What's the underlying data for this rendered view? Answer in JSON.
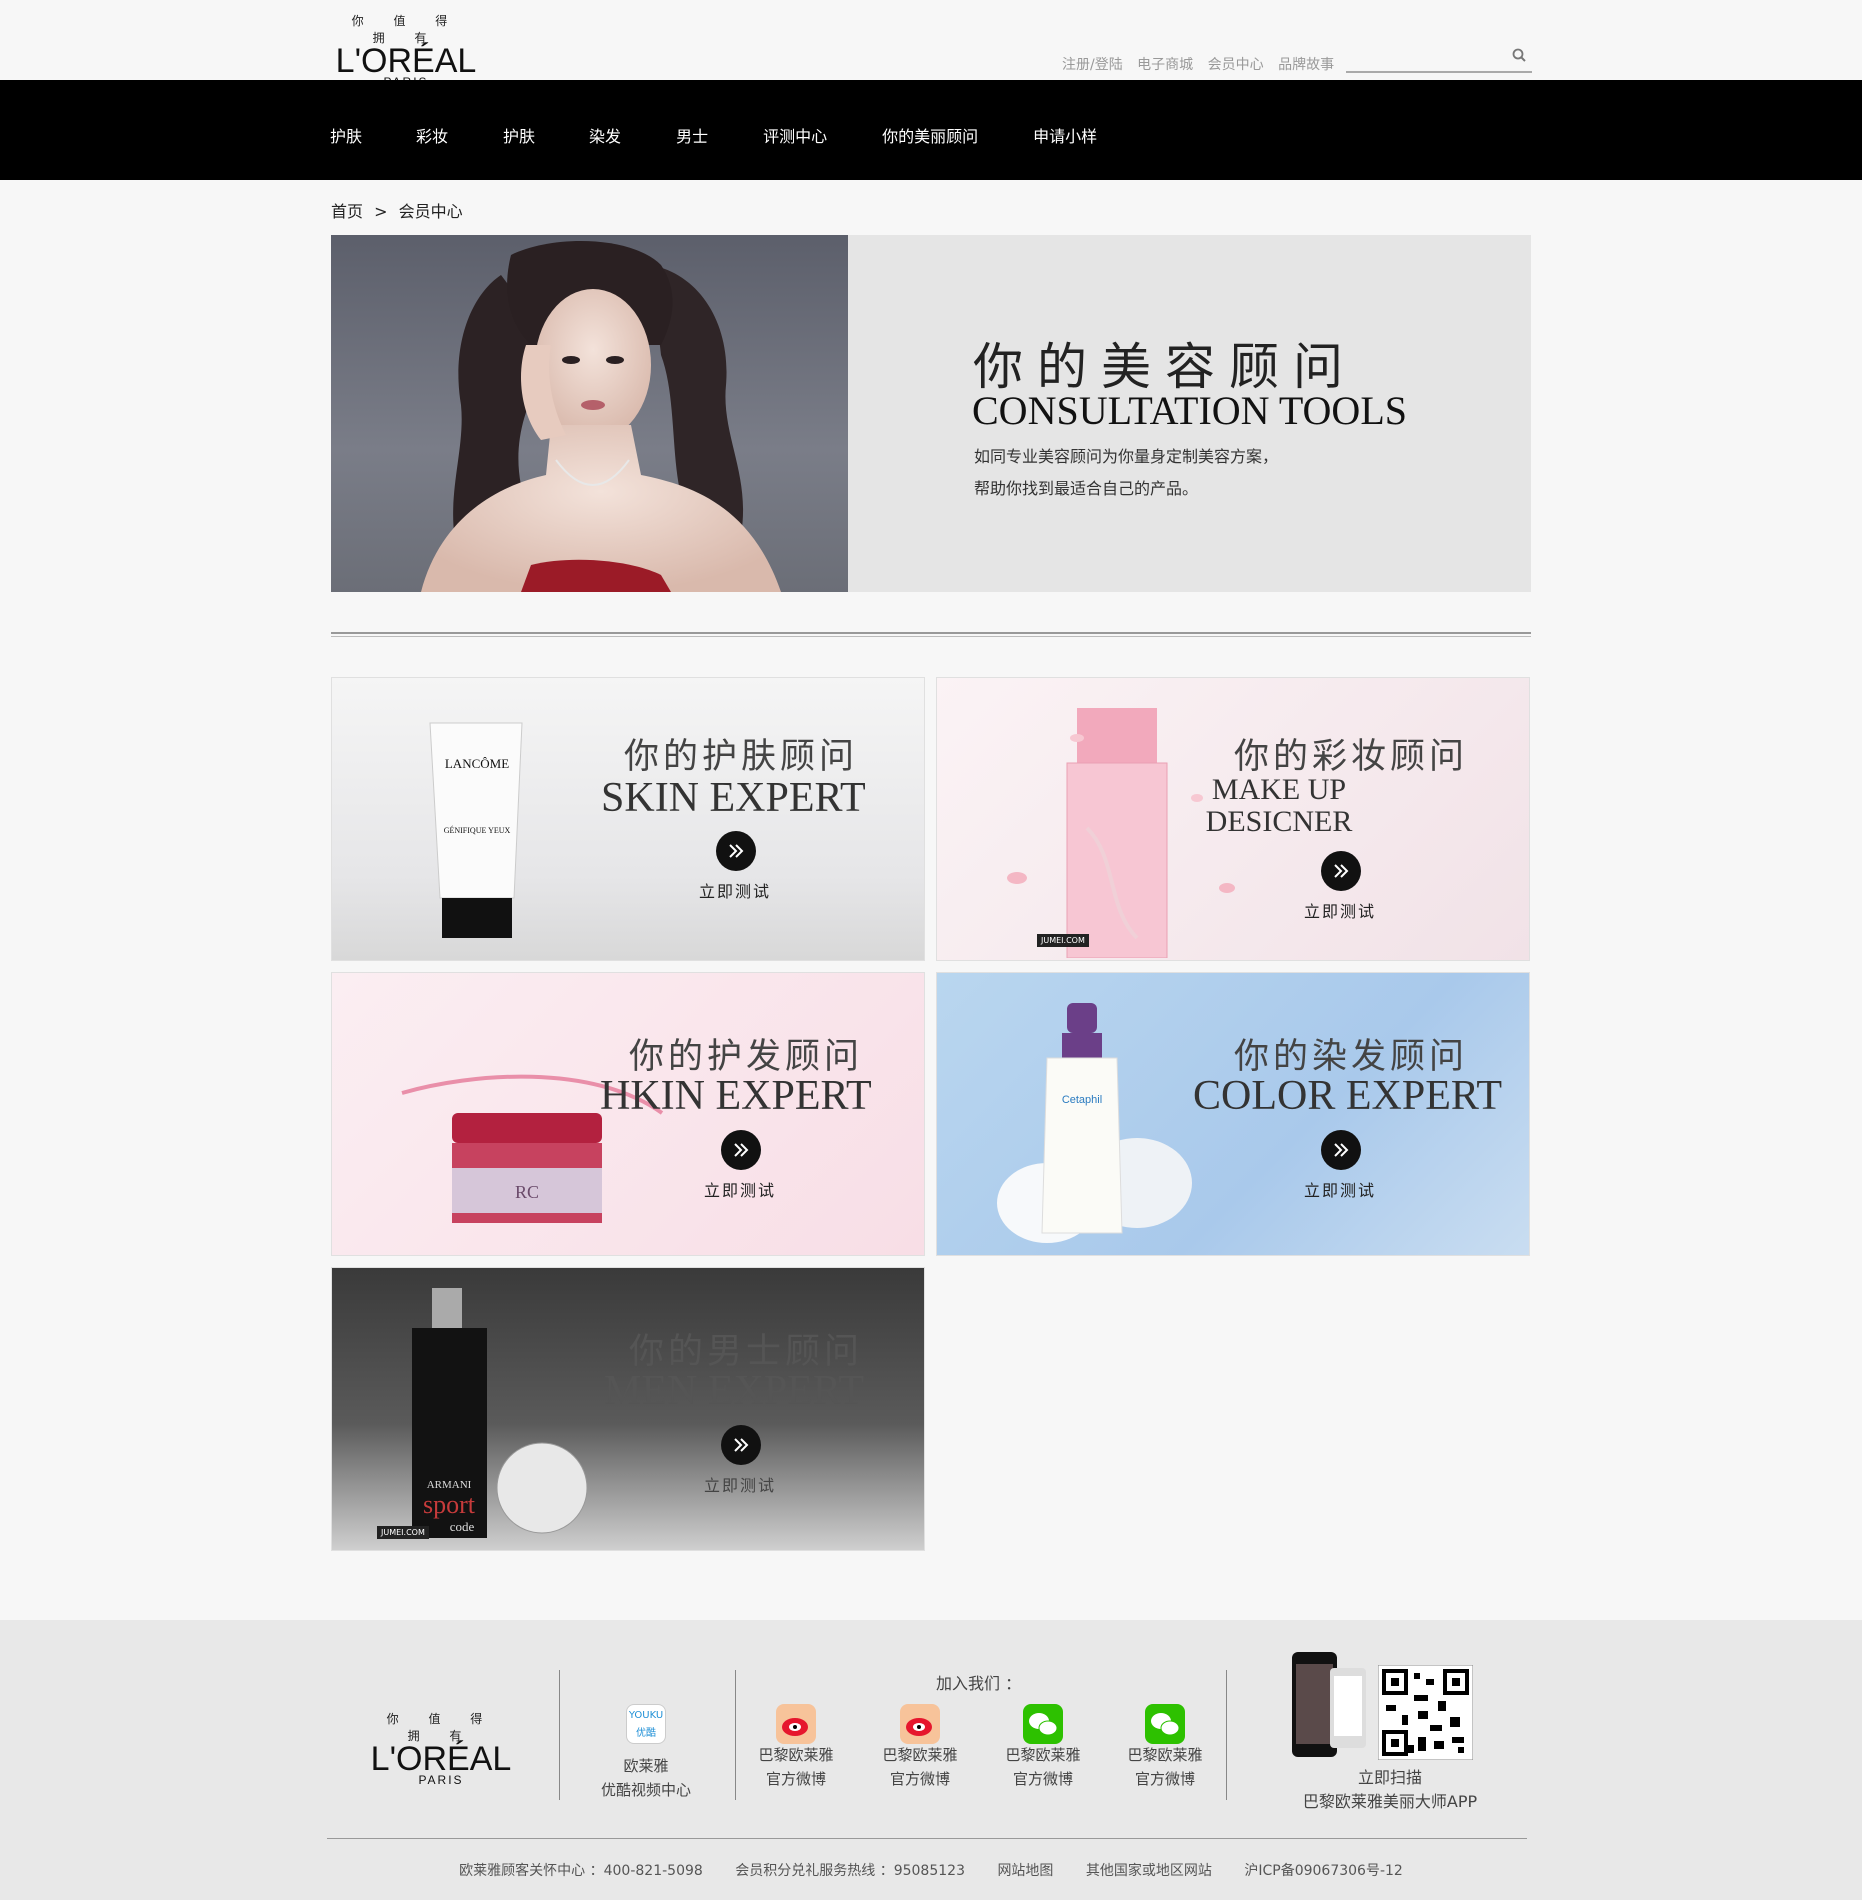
{
  "logo": {
    "tagline": "你 值 得 拥 有",
    "brand": "L'ORÉAL",
    "city": "PARIS"
  },
  "top_links": [
    "注册/登陆",
    "电子商城",
    "会员中心",
    "品牌故事"
  ],
  "search": {
    "placeholder": ""
  },
  "nav": [
    "护肤",
    "彩妆",
    "护肤",
    "染发",
    "男士",
    "评测中心",
    "你的美丽顾问",
    "申请小样"
  ],
  "breadcrumb": {
    "home": "首页",
    "sep": ">",
    "current": "会员中心"
  },
  "hero": {
    "title_cn": "你的美容顾问",
    "title_en": "CONSULTATION TOOLS",
    "desc_line1": "如同专业美容顾问为你量身定制美容方案，",
    "desc_line2": "帮助你找到最适合自己的产品。"
  },
  "cards": [
    {
      "cn": "你的护肤顾问",
      "en": "SKIN EXPERT",
      "test": "立即测试",
      "product_text": "LANCÔME",
      "product_sub": "GÉNIFIQUE YEUX"
    },
    {
      "cn": "你的彩妆顾问",
      "en_line1": "MAKE UP",
      "en_line2": "DESICNER",
      "test": "立即测试",
      "watermark": "JUMEI.COM"
    },
    {
      "cn": "你的护发顾问",
      "en": "HKIN EXPERT",
      "test": "立即测试",
      "product_text": "RC"
    },
    {
      "cn": "你的染发顾问",
      "en": "COLOR EXPERT",
      "test": "立即测试",
      "product_text": "Cetaphil"
    },
    {
      "cn": "你的男士顾问",
      "en": "MEN EXPERT",
      "test": "立即测试",
      "product_text": "ARMANI",
      "product_sub": "sport",
      "product_sub2": "code",
      "watermark": "JUMEI.COM"
    }
  ],
  "footer": {
    "youku": {
      "badge": "YOUKU 优酷",
      "line1": "欧莱雅",
      "line2": "优酷视频中心"
    },
    "join_label": "加入我们 ：",
    "socials": [
      {
        "line1": "巴黎欧莱雅",
        "line2": "官方微博",
        "icon": "weibo-icon"
      },
      {
        "line1": "巴黎欧莱雅",
        "line2": "官方微博",
        "icon": "weibo-icon"
      },
      {
        "line1": "巴黎欧莱雅",
        "line2": "官方微博",
        "icon": "wechat-icon"
      },
      {
        "line1": "巴黎欧莱雅",
        "line2": "官方微博",
        "icon": "wechat-icon"
      }
    ],
    "app": {
      "line1": "立即扫描",
      "line2": "巴黎欧莱雅美丽大师APP"
    },
    "bottom": [
      "欧莱雅顾客关怀中心 ：400-821-5098",
      "会员积分兑礼服务热线 ：95085123",
      "网站地图",
      "其他国家或地区网站",
      "沪ICP备09067306号-12"
    ]
  },
  "colors": {
    "nav_bg": "#000000",
    "page_bg": "#f7f7f7",
    "weibo": "#e6162d",
    "wechat": "#2dc100"
  }
}
